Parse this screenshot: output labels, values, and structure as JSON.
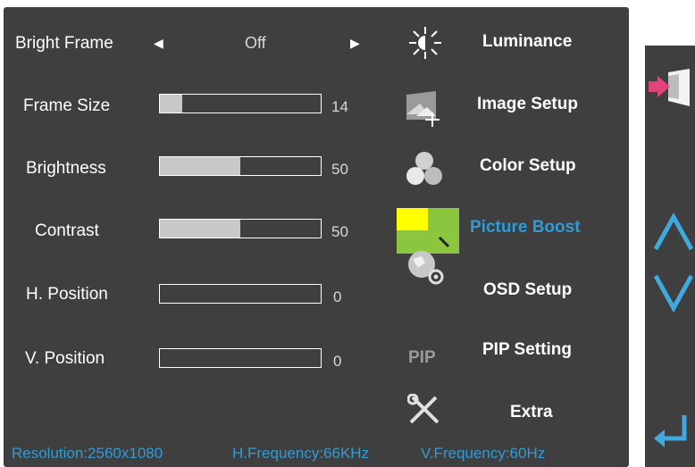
{
  "settings": {
    "bright_frame": {
      "label": "Bright Frame",
      "value": "Off"
    },
    "frame_size": {
      "label": "Frame Size",
      "value": 14,
      "value_text": "14"
    },
    "brightness": {
      "label": "Brightness",
      "value": 50,
      "value_text": "50"
    },
    "contrast": {
      "label": "Contrast",
      "value": 50,
      "value_text": "50"
    },
    "h_position": {
      "label": "H. Position",
      "value": 0,
      "value_text": "0"
    },
    "v_position": {
      "label": "V. Position",
      "value": 0,
      "value_text": "0"
    }
  },
  "menu": [
    {
      "label": "Luminance",
      "icon": "sun-icon"
    },
    {
      "label": "Image Setup",
      "icon": "image-setup-icon"
    },
    {
      "label": "Color Setup",
      "icon": "color-setup-icon"
    },
    {
      "label": "Picture Boost",
      "icon": "picture-boost-icon",
      "active": true
    },
    {
      "label": "OSD Setup",
      "icon": "osd-setup-icon"
    },
    {
      "label": "PIP Setting",
      "icon": "pip-icon",
      "icon_text": "PIP"
    },
    {
      "label": "Extra",
      "icon": "tools-icon"
    }
  ],
  "status": {
    "resolution": "Resolution:2560x1080",
    "h_frequency": "H.Frequency:66KHz",
    "v_frequency": "V.Frequency:60Hz"
  },
  "colors": {
    "panel": "#3f3f3f",
    "accent": "#2f9bd7",
    "bar_fill": "#c8c8c8"
  }
}
